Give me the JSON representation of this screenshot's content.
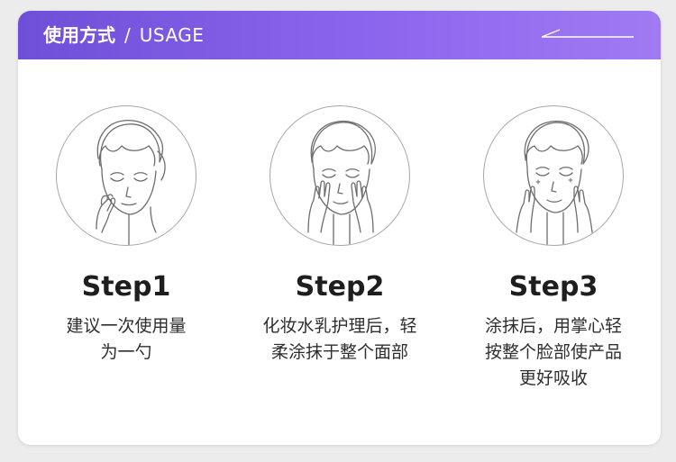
{
  "header": {
    "title_zh": "使用方式",
    "separator": "/",
    "title_en": "USAGE"
  },
  "steps": [
    {
      "title": "Step1",
      "desc_lines": [
        "建议一次使用量",
        "为一勺"
      ],
      "illustration": "face-hand-on-cheek-icon"
    },
    {
      "title": "Step2",
      "desc_lines": [
        "化妆水乳护理后，轻",
        "柔涂抹于整个面部"
      ],
      "illustration": "face-both-hands-on-cheeks-icon"
    },
    {
      "title": "Step3",
      "desc_lines": [
        "涂抹后，用掌心轻",
        "按整个脸部使产品",
        "更好吸收"
      ],
      "illustration": "face-palms-pressing-icon"
    }
  ],
  "colors": {
    "header_gradient_start": "#6f4fd8",
    "header_gradient_end": "#a07af2",
    "card_background": "#ffffff",
    "page_background": "#ececec",
    "title_text": "#1e1e1e",
    "body_text": "#2e2e2e"
  }
}
